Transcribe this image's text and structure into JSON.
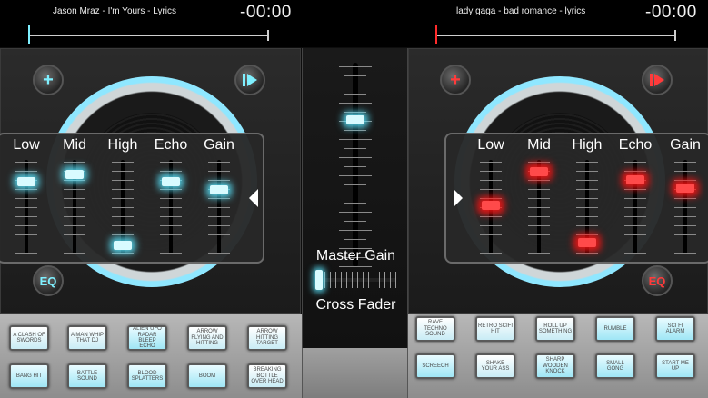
{
  "deck_a": {
    "track_title": "Jason Mraz - I'm Yours - Lyrics",
    "time": "-00:00",
    "progress_percent": 0,
    "accent_color": "#7ff0ff",
    "add_icon": "plus-icon",
    "play_icon": "play-pause-icon",
    "eq_button_label": "EQ",
    "eq": {
      "labels": [
        "Low",
        "Mid",
        "High",
        "Echo",
        "Gain"
      ],
      "levels_percent": [
        80,
        88,
        5,
        80,
        70
      ]
    }
  },
  "deck_b": {
    "track_title": "lady gaga - bad romance - lyrics",
    "time": "-00:00",
    "progress_percent": 0,
    "accent_color": "#ff3b3b",
    "add_icon": "plus-icon",
    "play_icon": "play-pause-icon",
    "eq_button_label": "EQ",
    "eq": {
      "labels": [
        "Low",
        "Mid",
        "High",
        "Echo",
        "Gain"
      ],
      "levels_percent": [
        52,
        92,
        8,
        82,
        72
      ]
    }
  },
  "mixer": {
    "master_gain_label": "Master Gain",
    "master_gain_percent": 73,
    "cross_fader_label": "Cross Fader",
    "cross_fader_percent": 0
  },
  "pads_left": [
    {
      "label": "A CLASH OF SWORDS"
    },
    {
      "label": "A MAN WHIP THAT DJ"
    },
    {
      "label": "ALIEN UFO RADAR BLEEP ECHO"
    },
    {
      "label": "ARROW FLYING AND HITTING"
    },
    {
      "label": "ARROW HITTING TARGET"
    },
    {
      "label": "BANG HIT"
    },
    {
      "label": "BATTLE SOUND"
    },
    {
      "label": "BLOOD SPLATTERS"
    },
    {
      "label": "BOOM"
    },
    {
      "label": "BREAKING BOTTLE OVER HEAD"
    }
  ],
  "pads_right": [
    {
      "label": "RAVE TECHNO SOUND"
    },
    {
      "label": "RETRO SCIFI HIT"
    },
    {
      "label": "ROLL UP SOMETHING"
    },
    {
      "label": "RUMBLE"
    },
    {
      "label": "SCI FI ALARM"
    },
    {
      "label": "SCREECH"
    },
    {
      "label": "SHAKE YOUR ASS"
    },
    {
      "label": "SHARP WOODEN KNOCK"
    },
    {
      "label": "SMALL GONG"
    },
    {
      "label": "START ME UP"
    }
  ]
}
